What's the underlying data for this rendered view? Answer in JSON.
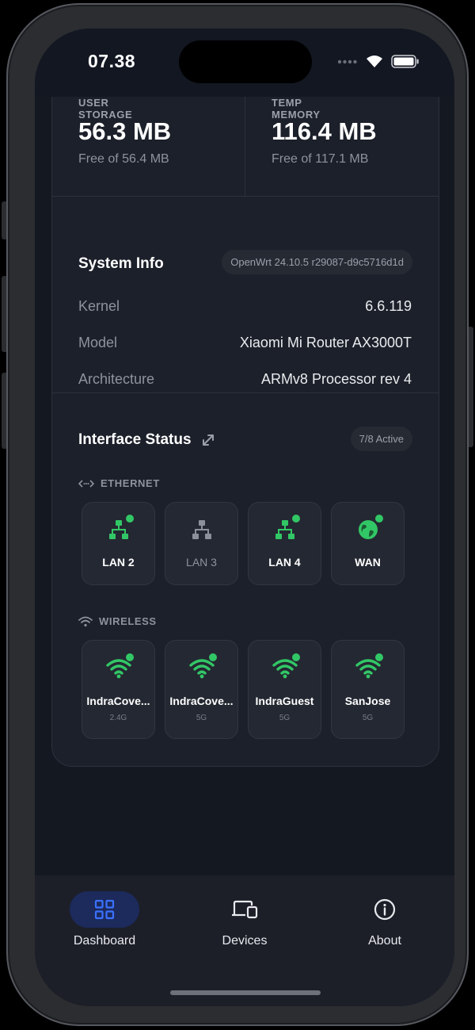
{
  "status_bar": {
    "time": "07.38"
  },
  "storage": {
    "user": {
      "label": "USER STORAGE",
      "value": "56.3 MB",
      "free": "Free of 56.4 MB"
    },
    "temp": {
      "label": "TEMP MEMORY",
      "value": "116.4 MB",
      "free": "Free of 117.1 MB"
    }
  },
  "system_info": {
    "title": "System Info",
    "version": "OpenWrt 24.10.5 r29087-d9c5716d1d",
    "rows": [
      {
        "key": "Kernel",
        "value": "6.6.119"
      },
      {
        "key": "Model",
        "value": "Xiaomi Mi Router AX3000T"
      },
      {
        "key": "Architecture",
        "value": "ARMv8 Processor rev 4"
      }
    ]
  },
  "interface_status": {
    "title": "Interface Status",
    "active_badge": "7/8 Active",
    "ethernet_label": "ETHERNET",
    "wireless_label": "WIRELESS",
    "ethernet": [
      {
        "name": "LAN 2",
        "icon": "network-icon",
        "active": true
      },
      {
        "name": "LAN 3",
        "icon": "network-icon",
        "active": false
      },
      {
        "name": "LAN 4",
        "icon": "network-icon",
        "active": true
      },
      {
        "name": "WAN",
        "icon": "globe-icon",
        "active": true
      }
    ],
    "wireless": [
      {
        "name": "IndraCove...",
        "band": "2.4G",
        "active": true
      },
      {
        "name": "IndraCove...",
        "band": "5G",
        "active": true
      },
      {
        "name": "IndraGuest",
        "band": "5G",
        "active": true
      },
      {
        "name": "SanJose",
        "band": "5G",
        "active": true
      }
    ]
  },
  "tabs": [
    {
      "label": "Dashboard",
      "icon": "grid-icon",
      "selected": true
    },
    {
      "label": "Devices",
      "icon": "devices-icon",
      "selected": false
    },
    {
      "label": "About",
      "icon": "info-icon",
      "selected": false
    }
  ],
  "colors": {
    "active_green": "#32c766",
    "accent_blue": "#2f6bff",
    "inactive_gray": "#8d939d"
  }
}
